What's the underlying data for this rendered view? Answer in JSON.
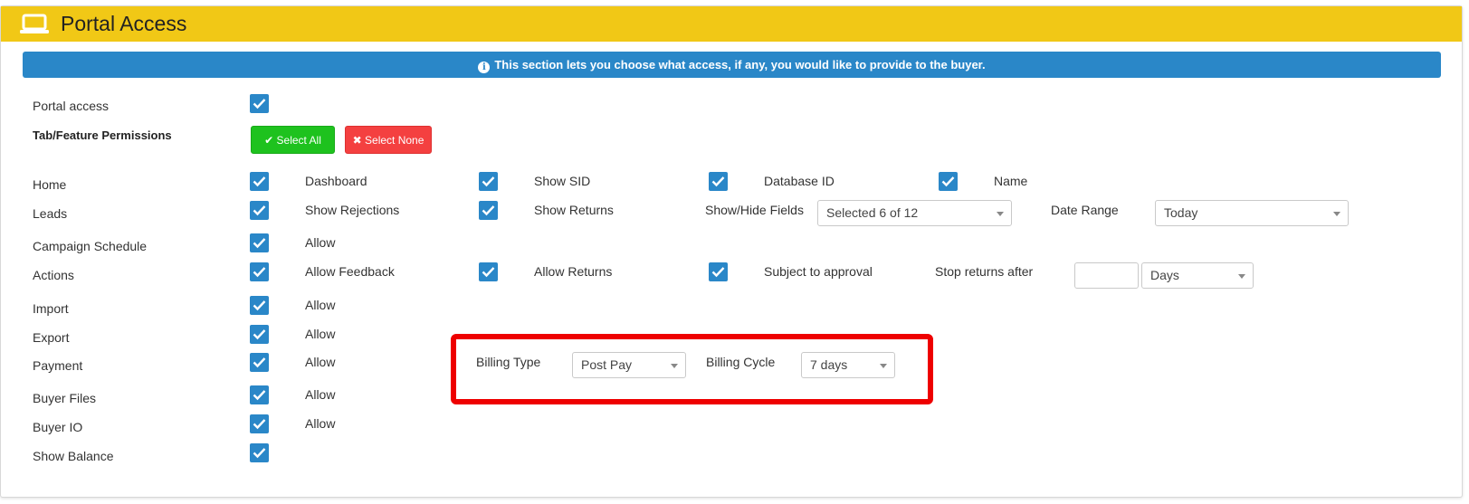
{
  "header": {
    "title": "Portal Access",
    "icon": "laptop-icon"
  },
  "info": {
    "text": "This section lets you choose what access, if any, you would like to provide to the buyer."
  },
  "portal_access": {
    "label": "Portal access",
    "checked": true
  },
  "permissions": {
    "label": "Tab/Feature Permissions",
    "select_all": "Select All",
    "select_none": "Select None"
  },
  "rows": {
    "home": {
      "label": "Home",
      "c1": "Dashboard",
      "c2": "Show SID",
      "c3": "Database ID",
      "c4": "Name"
    },
    "leads": {
      "label": "Leads",
      "c1": "Show Rejections",
      "c2": "Show Returns",
      "show_hide_label": "Show/Hide Fields",
      "show_hide_value": "Selected 6 of 12",
      "date_range_label": "Date Range",
      "date_range_value": "Today"
    },
    "campaign": {
      "label": "Campaign Schedule",
      "c1": "Allow"
    },
    "actions": {
      "label": "Actions",
      "c1": "Allow Feedback",
      "c2": "Allow Returns",
      "c3": "Subject to approval",
      "stop_label": "Stop returns after",
      "stop_value": "",
      "stop_unit": "Days"
    },
    "import": {
      "label": "Import",
      "c1": "Allow"
    },
    "export": {
      "label": "Export",
      "c1": "Allow"
    },
    "payment": {
      "label": "Payment",
      "c1": "Allow"
    },
    "buyer_files": {
      "label": "Buyer Files",
      "c1": "Allow"
    },
    "buyer_io": {
      "label": "Buyer IO",
      "c1": "Allow"
    },
    "show_balance": {
      "label": "Show Balance"
    }
  },
  "billing": {
    "type_label": "Billing Type",
    "type_value": "Post Pay",
    "cycle_label": "Billing Cycle",
    "cycle_value": "7 days"
  },
  "colors": {
    "header_bg": "#f1c816",
    "info_bg": "#2a87c8",
    "checkbox": "#2a87c8",
    "select_all": "#1ec21e",
    "select_none": "#f44040",
    "highlight": "#ee0000"
  }
}
